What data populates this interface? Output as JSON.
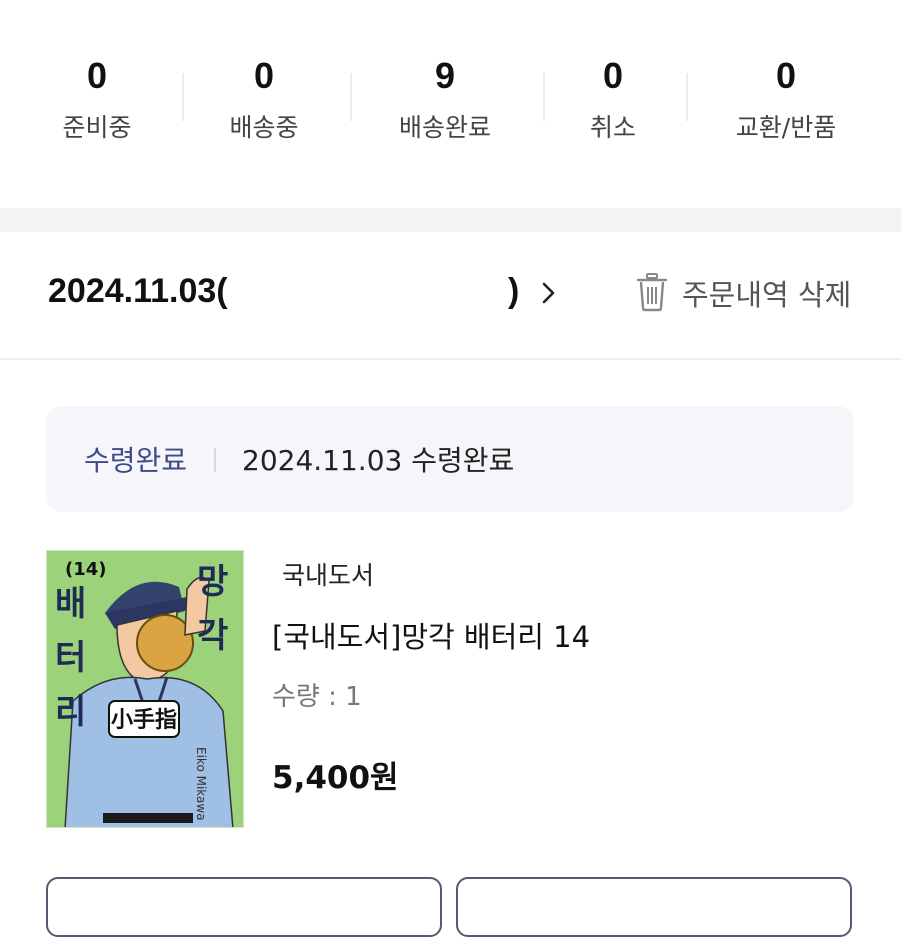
{
  "stats": [
    {
      "count": "0",
      "label": "준비중"
    },
    {
      "count": "0",
      "label": "배송중"
    },
    {
      "count": "9",
      "label": "배송완료"
    },
    {
      "count": "0",
      "label": "취소"
    },
    {
      "count": "0",
      "label": "교환/반품"
    }
  ],
  "order": {
    "date_open": "2024.11.03(",
    "date_close": ")",
    "delete_label": "주문내역 삭제"
  },
  "status": {
    "tag": "수령완료",
    "text": "2024.11.03 수령완료"
  },
  "product": {
    "category": "국내도서",
    "title": "[국내도서]망각 배터리 14",
    "quantity": "수량 : 1",
    "price": "5,400원",
    "cover": {
      "volume": "(14)",
      "title_chars": [
        "망",
        "각",
        "배",
        "터",
        "리"
      ],
      "emblem": "小手指",
      "author": "Eiko Mikawa"
    }
  },
  "colors": {
    "accent": "#3f4a8a",
    "cover_bg": "#9bd27a",
    "status_bg": "#f6f6fa"
  }
}
